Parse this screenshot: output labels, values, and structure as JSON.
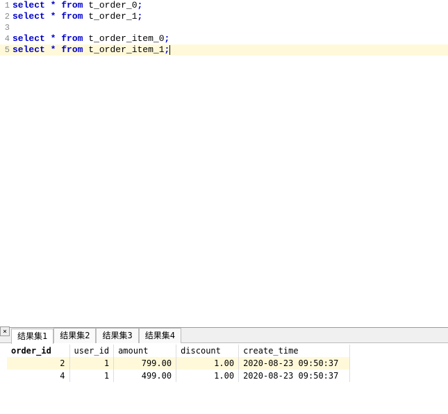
{
  "editor": {
    "currentLine": 5,
    "lines": [
      {
        "number": "1",
        "tokens": [
          {
            "t": "kw",
            "v": "select"
          },
          {
            "t": "sp",
            "v": " "
          },
          {
            "t": "op",
            "v": "*"
          },
          {
            "t": "sp",
            "v": " "
          },
          {
            "t": "kw",
            "v": "from"
          },
          {
            "t": "sp",
            "v": " "
          },
          {
            "t": "ident",
            "v": "t_order_0"
          },
          {
            "t": "op",
            "v": ";"
          }
        ]
      },
      {
        "number": "2",
        "tokens": [
          {
            "t": "kw",
            "v": "select"
          },
          {
            "t": "sp",
            "v": " "
          },
          {
            "t": "op",
            "v": "*"
          },
          {
            "t": "sp",
            "v": " "
          },
          {
            "t": "kw",
            "v": "from"
          },
          {
            "t": "sp",
            "v": " "
          },
          {
            "t": "ident",
            "v": "t_order_1"
          },
          {
            "t": "op",
            "v": ";"
          }
        ]
      },
      {
        "number": "3",
        "tokens": []
      },
      {
        "number": "4",
        "tokens": [
          {
            "t": "kw",
            "v": "select"
          },
          {
            "t": "sp",
            "v": " "
          },
          {
            "t": "op",
            "v": "*"
          },
          {
            "t": "sp",
            "v": " "
          },
          {
            "t": "kw",
            "v": "from"
          },
          {
            "t": "sp",
            "v": " "
          },
          {
            "t": "ident",
            "v": "t_order_item_0"
          },
          {
            "t": "op",
            "v": ";"
          }
        ]
      },
      {
        "number": "5",
        "tokens": [
          {
            "t": "kw",
            "v": "select"
          },
          {
            "t": "sp",
            "v": " "
          },
          {
            "t": "op",
            "v": "*"
          },
          {
            "t": "sp",
            "v": " "
          },
          {
            "t": "kw",
            "v": "from"
          },
          {
            "t": "sp",
            "v": " "
          },
          {
            "t": "ident",
            "v": "t_order_item_1"
          },
          {
            "t": "op",
            "v": ";"
          }
        ]
      }
    ]
  },
  "results": {
    "close_symbol": "×",
    "activeTab": 0,
    "tabs": [
      {
        "label": "结果集1"
      },
      {
        "label": "结果集2"
      },
      {
        "label": "结果集3"
      },
      {
        "label": "结果集4"
      }
    ],
    "columns": [
      {
        "label": "order_id",
        "first": true
      },
      {
        "label": "user_id"
      },
      {
        "label": "amount"
      },
      {
        "label": "discount"
      },
      {
        "label": "create_time"
      }
    ],
    "rows": [
      {
        "highlight": true,
        "cells": [
          {
            "v": "2",
            "num": true
          },
          {
            "v": "1",
            "num": true
          },
          {
            "v": "799.00",
            "num": true
          },
          {
            "v": "1.00",
            "num": true
          },
          {
            "v": "2020-08-23 09:50:37"
          }
        ]
      },
      {
        "highlight": false,
        "cells": [
          {
            "v": "4",
            "num": true
          },
          {
            "v": "1",
            "num": true
          },
          {
            "v": "499.00",
            "num": true
          },
          {
            "v": "1.00",
            "num": true
          },
          {
            "v": "2020-08-23 09:50:37"
          }
        ]
      }
    ]
  }
}
